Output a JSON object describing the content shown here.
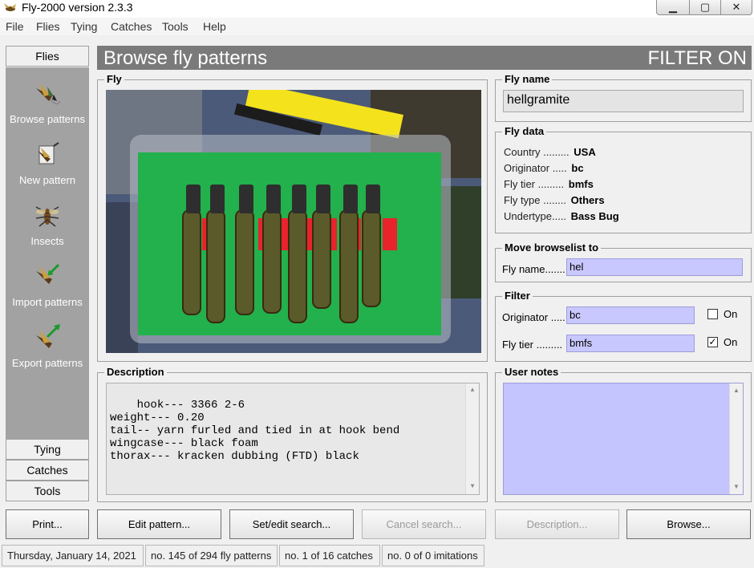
{
  "window": {
    "title": "Fly-2000  version 2.3.3",
    "controls": {
      "minimize": "▁",
      "maximize": "▢",
      "close": "✕"
    }
  },
  "menu": [
    "File",
    "Flies",
    "Tying",
    "Catches",
    "Tools",
    "Help"
  ],
  "nav": {
    "top_button": "Flies",
    "items": [
      {
        "label": "Browse patterns",
        "icon": "fly-icon"
      },
      {
        "label": "New pattern",
        "icon": "new-pattern-icon"
      },
      {
        "label": "Insects",
        "icon": "insect-icon"
      },
      {
        "label": "Import patterns",
        "icon": "import-icon"
      },
      {
        "label": "Export patterns",
        "icon": "export-icon"
      }
    ],
    "bottom_buttons": [
      "Tying",
      "Catches",
      "Tools"
    ]
  },
  "header": {
    "title": "Browse fly patterns",
    "filter_status": "FILTER ON"
  },
  "fly_group": {
    "title": "Fly"
  },
  "description": {
    "title": "Description",
    "text": "hook--- 3366 2-6\nweight--- 0.20\ntail-- yarn furled and tied in at hook bend\nwingcase--- black foam\nthorax--- kracken dubbing (FTD) black"
  },
  "fly_name": {
    "title": "Fly name",
    "value": "hellgramite"
  },
  "fly_data": {
    "title": "Fly data",
    "rows": [
      {
        "label": "Country .........",
        "value": "USA"
      },
      {
        "label": "Originator .....",
        "value": "bc"
      },
      {
        "label": "Fly tier .........",
        "value": "bmfs"
      },
      {
        "label": "Fly type ........",
        "value": "Others"
      },
      {
        "label": "Undertype.....",
        "value": "Bass Bug"
      }
    ]
  },
  "browselist": {
    "title": "Move browselist to",
    "label": "Fly name.......",
    "value": "hel"
  },
  "filter": {
    "title": "Filter",
    "originator_label": "Originator .....",
    "originator_value": "bc",
    "originator_on": false,
    "tier_label": "Fly tier  .........",
    "tier_value": "bmfs",
    "tier_on": true,
    "on_label": "On",
    "check_mark": "✓"
  },
  "user_notes": {
    "title": "User notes",
    "text": ""
  },
  "buttons": {
    "print": "Print...",
    "edit_pattern": "Edit pattern...",
    "set_edit_search": "Set/edit search...",
    "cancel_search": "Cancel search...",
    "description": "Description...",
    "browse": "Browse..."
  },
  "status": {
    "date": "Thursday, January 14, 2021",
    "patterns": "no. 145 of 294 fly patterns",
    "catches": "no. 1 of 16 catches",
    "imitations": "no. 0 of 0 imitations"
  },
  "colors": {
    "header_bg": "#7a7a7a",
    "nav_bg": "#a2a2a2",
    "input_purple": "#c8c8ff",
    "notes_purple": "#c4c4ff",
    "photo_green": "#1fb34d"
  }
}
